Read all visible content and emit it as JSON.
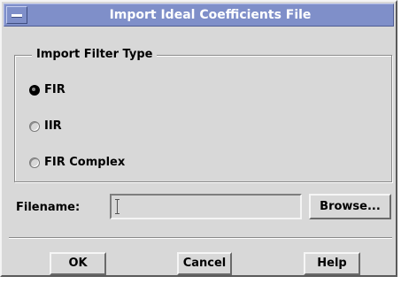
{
  "window": {
    "title": "Import Ideal Coefficients File"
  },
  "filter_type": {
    "group_label": "Import Filter Type",
    "options": [
      {
        "label": "FIR",
        "selected": true
      },
      {
        "label": "IIR",
        "selected": false
      },
      {
        "label": "FIR Complex",
        "selected": false
      }
    ]
  },
  "filename": {
    "label": "Filename:",
    "value": "",
    "browse_label": "Browse..."
  },
  "buttons": {
    "ok_label": "OK",
    "cancel_label": "Cancel",
    "help_label": "Help"
  },
  "colors": {
    "titlebar": "#7f8fc9",
    "background": "#d8d8d8"
  }
}
